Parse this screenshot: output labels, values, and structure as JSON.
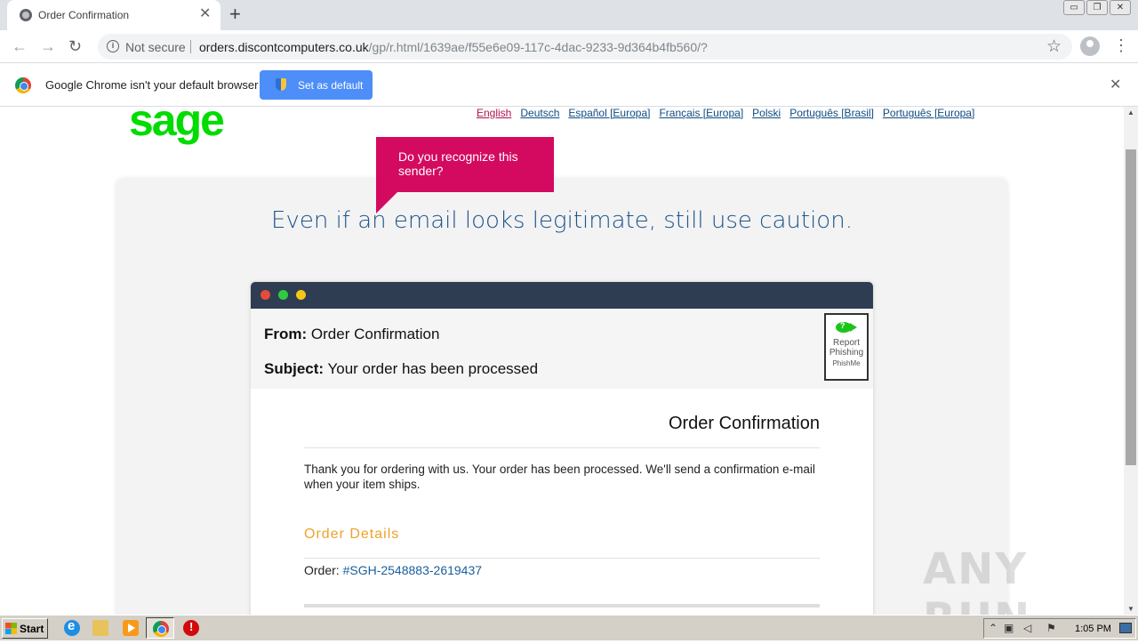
{
  "browser": {
    "tab_title": "Order Confirmation",
    "tab_close": "✕",
    "new_tab": "+",
    "security_label": "Not secure",
    "url_domain": "orders.discontcomputers.co.uk",
    "url_path": "/gp/r.html/1639ae/f55e6e09-117c-4dac-9233-9d364b4fb560/?",
    "window_controls": [
      "▭",
      "❐",
      "✕"
    ]
  },
  "infobar": {
    "message": "Google Chrome isn't your default browser",
    "button_label": "Set as default",
    "close": "✕"
  },
  "page": {
    "logo_text": "sage",
    "languages": [
      {
        "label": "English",
        "active": true
      },
      {
        "label": "Deutsch"
      },
      {
        "label": "Español [Europa]"
      },
      {
        "label": "Français [Europa]"
      },
      {
        "label": "Polski"
      },
      {
        "label": "Português [Brasil]"
      },
      {
        "label": "Português [Europa]"
      }
    ],
    "headline": "Even if an email looks legitimate, still use caution.",
    "tooltip": "Do you recognize this sender?",
    "email": {
      "from_label": "From:",
      "from_value": "Order Confirmation",
      "subject_label": "Subject:",
      "subject_value": "Your order has been processed",
      "report_button": {
        "line1": "Report",
        "line2": "Phishing",
        "brand": "PhishMe"
      },
      "body_title": "Order Confirmation",
      "body_text": "Thank you for ordering with us. Your order has been processed. We'll send a confirmation e-mail when your item ships.",
      "details_heading": "Order Details",
      "order_label": "Order:",
      "order_number": "#SGH-2548883-2619437"
    }
  },
  "colors": {
    "sage_green": "#00dc00",
    "headline_blue": "#1d5489",
    "tooltip_magenta": "#d30a5f",
    "details_orange": "#f0a12a",
    "window_bar": "#2e3d52",
    "dot_red": "#e64b3c",
    "dot_green": "#2ecc40",
    "dot_yellow": "#f5c518"
  },
  "taskbar": {
    "start_label": "Start",
    "clock": "1:05 PM"
  },
  "watermark": "ANY RUN"
}
